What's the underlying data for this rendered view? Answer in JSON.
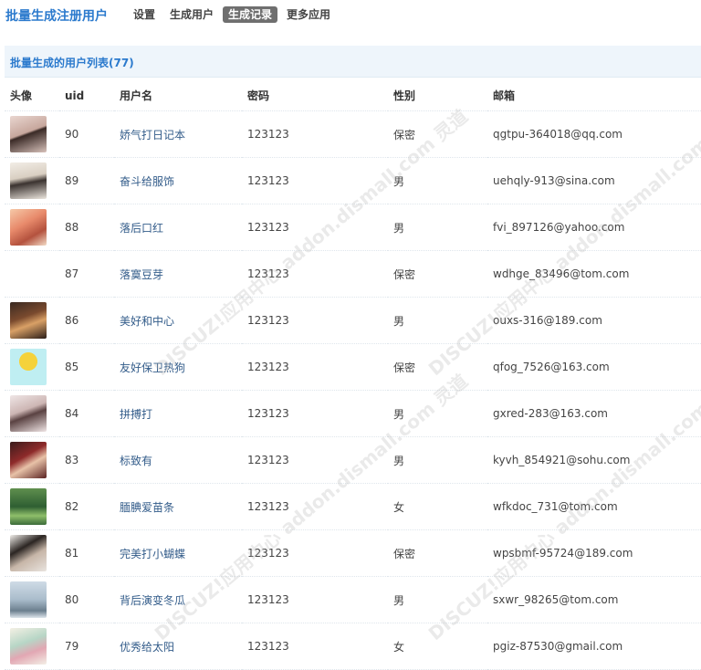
{
  "header": {
    "app_title": "批量生成注册用户",
    "tabs": [
      {
        "label": "设置",
        "active": false
      },
      {
        "label": "生成用户",
        "active": false
      },
      {
        "label": "生成记录",
        "active": true
      },
      {
        "label": "更多应用",
        "active": false
      }
    ]
  },
  "panel": {
    "title": "批量生成的用户列表",
    "count": "(77)"
  },
  "table": {
    "columns": [
      "头像",
      "uid",
      "用户名",
      "密码",
      "性别",
      "邮箱"
    ],
    "rows": [
      {
        "avatar": "woman-portrait",
        "uid": "90",
        "username": "娇气打日记本",
        "password": "123123",
        "gender": "保密",
        "email": "qgtpu-364018@qq.com"
      },
      {
        "avatar": "ink-painting-girl",
        "uid": "89",
        "username": "奋斗给服饰",
        "password": "123123",
        "gender": "男",
        "email": "uehqly-913@sina.com"
      },
      {
        "avatar": "illustrated-girl",
        "uid": "88",
        "username": "落后口红",
        "password": "123123",
        "gender": "男",
        "email": "fvi_897126@yahoo.com"
      },
      {
        "avatar": "",
        "uid": "87",
        "username": "落寞豆芽",
        "password": "123123",
        "gender": "保密",
        "email": "wdhge_83496@tom.com"
      },
      {
        "avatar": "cafe-drinks",
        "uid": "86",
        "username": "美好和中心",
        "password": "123123",
        "gender": "男",
        "email": "ouxs-316@189.com"
      },
      {
        "avatar": "cartoon-balloon",
        "uid": "85",
        "username": "友好保卫热狗",
        "password": "123123",
        "gender": "保密",
        "email": "qfog_7526@163.com"
      },
      {
        "avatar": "girl-portrait",
        "uid": "84",
        "username": "拼搏打",
        "password": "123123",
        "gender": "男",
        "email": "gxred-283@163.com"
      },
      {
        "avatar": "red-dress-woman",
        "uid": "83",
        "username": "标致有",
        "password": "123123",
        "gender": "男",
        "email": "kyvh_854921@sohu.com"
      },
      {
        "avatar": "forest-scene",
        "uid": "82",
        "username": "腼腆爱苗条",
        "password": "123123",
        "gender": "女",
        "email": "wfkdoc_731@tom.com"
      },
      {
        "avatar": "dark-hair-woman",
        "uid": "81",
        "username": "完美打小蝴蝶",
        "password": "123123",
        "gender": "保密",
        "email": "wpsbmf-95724@189.com"
      },
      {
        "avatar": "seaside-figure",
        "uid": "80",
        "username": "背后演变冬瓜",
        "password": "123123",
        "gender": "男",
        "email": "sxwr_98265@tom.com"
      },
      {
        "avatar": "painted-lady",
        "uid": "79",
        "username": "优秀给太阳",
        "password": "123123",
        "gender": "女",
        "email": "pgiz-87530@gmail.com"
      }
    ]
  },
  "watermark": {
    "text": "DISCUZ!应用中心 addon.dismall.com 灵道"
  },
  "colors": {
    "accent": "#2b7acd",
    "active_tab": "#6f6f6f",
    "panel_bg": "#eef5fb",
    "link": "#335c8a"
  }
}
